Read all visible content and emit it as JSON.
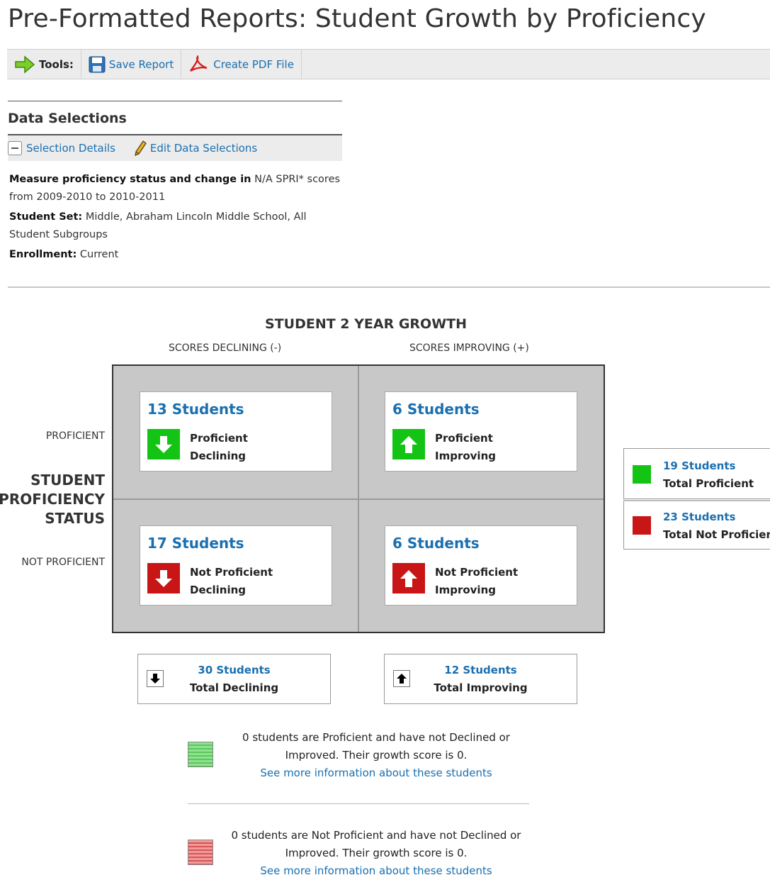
{
  "page": {
    "title": "Pre-Formatted Reports: Student Growth by Proficiency"
  },
  "toolbar": {
    "tools_label": "Tools:",
    "save_label": "Save Report",
    "pdf_label": "Create PDF File"
  },
  "data_selections": {
    "title": "Data Selections",
    "selection_details": "Selection Details",
    "edit_selections": "Edit Data Selections",
    "measure_prefix": "Measure proficiency status and change in",
    "measure_value": "N/A SPRI* scores from 2009-2010 to 2010-2011",
    "student_set_label": "Student Set:",
    "student_set_value": "Middle, Abraham Lincoln Middle School, All Student Subgroups",
    "enrollment_label": "Enrollment:",
    "enrollment_value": "Current"
  },
  "chart": {
    "title": "STUDENT 2 YEAR GROWTH",
    "col_declining": "SCORES DECLINING (-)",
    "col_improving": "SCORES IMPROVING (+)",
    "row_proficient": "PROFICIENT",
    "row_not_proficient": "NOT PROFICIENT",
    "axis_line1": "STUDENT",
    "axis_line2": "PROFICIENCY",
    "axis_line3": "STATUS"
  },
  "cells": {
    "prof_declining": {
      "count": "13 Students",
      "line1": "Proficient",
      "line2": "Declining"
    },
    "prof_improving": {
      "count": "6 Students",
      "line1": "Proficient",
      "line2": "Improving"
    },
    "notprof_declining": {
      "count": "17 Students",
      "line1": "Not Proficient",
      "line2": "Declining"
    },
    "notprof_improving": {
      "count": "6 Students",
      "line1": "Not Proficient",
      "line2": "Improving"
    }
  },
  "totals": {
    "proficient": {
      "count": "19 Students",
      "label": "Total Proficient"
    },
    "not_proficient": {
      "count": "23 Students",
      "label": "Total Not Proficient"
    },
    "declining": {
      "count": "30 Students",
      "label": "Total Declining"
    },
    "improving": {
      "count": "12 Students",
      "label": "Total Improving"
    }
  },
  "notes": {
    "proficient_line1": "0 students are Proficient and have not Declined or",
    "proficient_line2": "Improved. Their growth score is 0.",
    "proficient_link": "See more information about these students",
    "not_proficient_line1": "0 students are Not Proficient and have not Declined or",
    "not_proficient_line2": "Improved. Their growth score is 0.",
    "not_proficient_link": "See more information about these students"
  },
  "colors": {
    "link": "#1a6fb0",
    "proficient_green": "#14c414",
    "not_proficient_red": "#c81515"
  }
}
